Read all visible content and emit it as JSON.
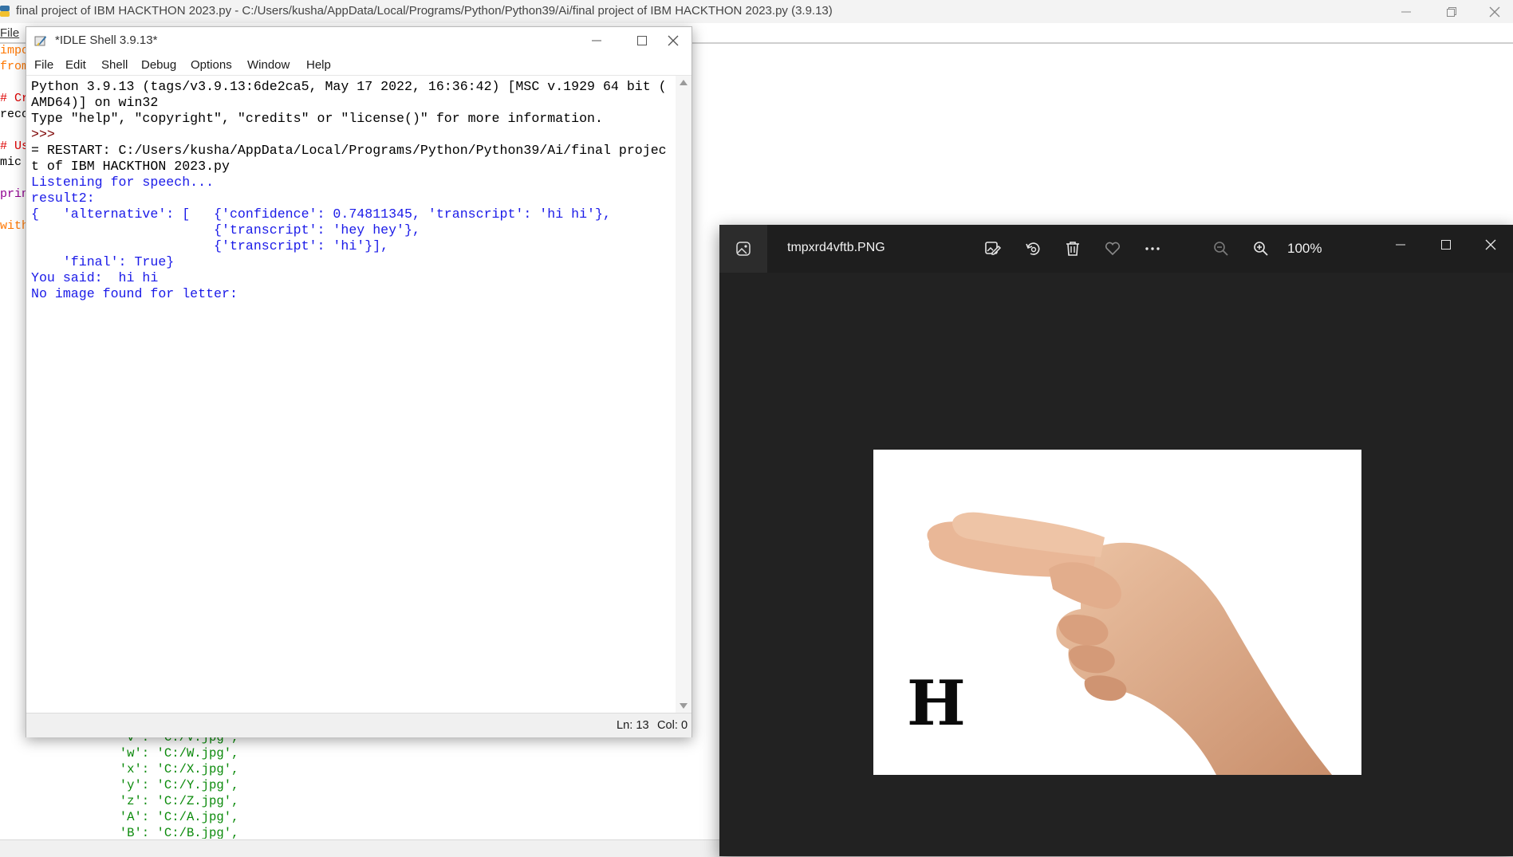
{
  "editor": {
    "title": "final project of IBM HACKTHON 2023.py - C:/Users/kusha/AppData/Local/Programs/Python/Python39/Ai/final project of IBM HACKTHON 2023.py (3.9.13)",
    "menu_file": "File",
    "code_fragments": [
      {
        "text": "impo",
        "color": "#ff7700"
      },
      {
        "text": "from",
        "color": "#ff7700"
      },
      {
        "text": "",
        "color": "#000000"
      },
      {
        "text": "# Cr",
        "color": "#dd0000"
      },
      {
        "text": "reco",
        "color": "#000000"
      },
      {
        "text": "",
        "color": "#000000"
      },
      {
        "text": "# Us",
        "color": "#dd0000"
      },
      {
        "text": "mic",
        "color": "#000000"
      },
      {
        "text": "",
        "color": "#000000"
      },
      {
        "text": "prin",
        "color": "#900090"
      },
      {
        "text": "",
        "color": "#000000"
      },
      {
        "text": "with",
        "color": "#ff7700"
      }
    ],
    "bottom_code": [
      "                'v': 'C:/V.jpg',",
      "                'w': 'C:/W.jpg',",
      "                'x': 'C:/X.jpg',",
      "                'y': 'C:/Y.jpg',",
      "                'z': 'C:/Z.jpg',",
      "                'A': 'C:/A.jpg',",
      "                'B': 'C:/B.jpg',"
    ]
  },
  "idle": {
    "title": "*IDLE Shell 3.9.13*",
    "menu": [
      "File",
      "Edit",
      "Shell",
      "Debug",
      "Options",
      "Window",
      "Help"
    ],
    "lines": [
      {
        "text": "Python 3.9.13 (tags/v3.9.13:6de2ca5, May 17 2022, 16:36:42) [MSC v.1929 64 bit (",
        "cls": ""
      },
      {
        "text": "AMD64)] on win32",
        "cls": ""
      },
      {
        "text": "Type \"help\", \"copyright\", \"credits\" or \"license()\" for more information.",
        "cls": ""
      },
      {
        "text": ">>> ",
        "cls": "darkred"
      },
      {
        "text": "= RESTART: C:/Users/kusha/AppData/Local/Programs/Python/Python39/Ai/final projec",
        "cls": ""
      },
      {
        "text": "t of IBM HACKTHON 2023.py",
        "cls": ""
      },
      {
        "text": "Listening for speech...",
        "cls": "blue"
      },
      {
        "text": "result2:",
        "cls": "blue"
      },
      {
        "text": "{   'alternative': [   {'confidence': 0.74811345, 'transcript': 'hi hi'},",
        "cls": "blue"
      },
      {
        "text": "                       {'transcript': 'hey hey'},",
        "cls": "blue"
      },
      {
        "text": "                       {'transcript': 'hi'}],",
        "cls": "blue"
      },
      {
        "text": "    'final': True}",
        "cls": "blue"
      },
      {
        "text": "You said:  hi hi",
        "cls": "blue"
      },
      {
        "text": "No image found for letter:",
        "cls": "blue"
      }
    ],
    "status_ln": "Ln: 13",
    "status_col": "Col: 0"
  },
  "photos": {
    "filename": "tmpxrd4vftb.PNG",
    "zoom": "100%",
    "image_letter": "H",
    "toolbar_icons": [
      "edit-image-icon",
      "rotate-icon",
      "delete-icon",
      "favorite-icon",
      "more-icon",
      "zoom-out-icon",
      "zoom-in-icon"
    ]
  }
}
